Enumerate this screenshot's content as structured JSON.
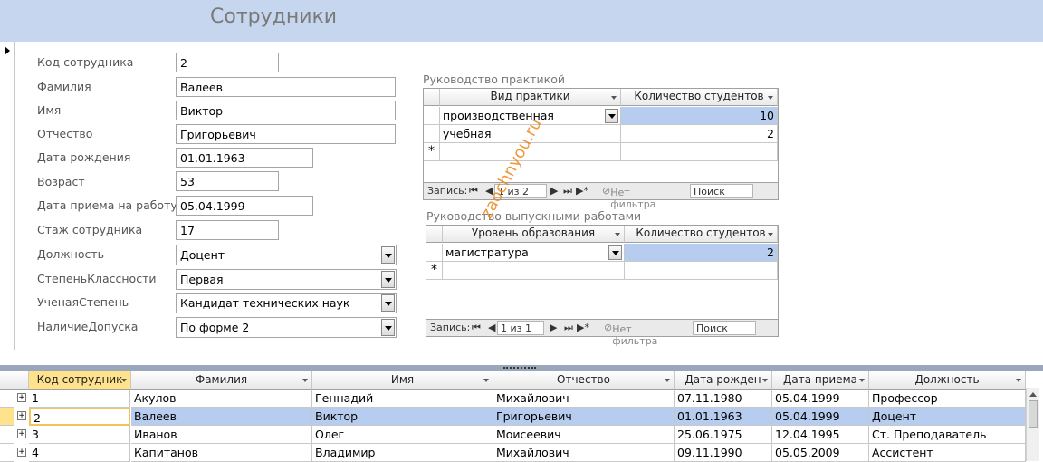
{
  "form": {
    "title": "Сотрудники",
    "fields": [
      {
        "label": "Код сотрудника",
        "value": "2"
      },
      {
        "label": "Фамилия",
        "value": "Валеев"
      },
      {
        "label": "Имя",
        "value": "Виктор"
      },
      {
        "label": "Отчество",
        "value": "Григорьевич"
      },
      {
        "label": "Дата рождения",
        "value": "01.01.1963"
      },
      {
        "label": "Возраст",
        "value": "53"
      },
      {
        "label": "Дата приема на работу",
        "value": "05.04.1999"
      },
      {
        "label": "Стаж сотрудника",
        "value": "17"
      }
    ],
    "combos": [
      {
        "label": "Должность",
        "value": "Доцент"
      },
      {
        "label": "СтепеньКлассности",
        "value": "Первая"
      },
      {
        "label": "УченаяСтепень",
        "value": "Кандидат технических наук"
      },
      {
        "label": "НаличиеДопуска",
        "value": "По форме 2"
      }
    ]
  },
  "practice": {
    "title": "Руководство практикой",
    "columns": [
      "Вид практики",
      "Количество студентов"
    ],
    "rows": [
      {
        "type": "производственная",
        "count": "10"
      },
      {
        "type": "учебная",
        "count": "2"
      }
    ],
    "new_row_marker": "*",
    "nav": {
      "label": "Запись:",
      "first": "⏮",
      "prev": "◀",
      "position": "1 из 2",
      "next": "▶",
      "last": "⏭",
      "new": "▶*",
      "filter": "Нет фильтра",
      "search": "Поиск"
    }
  },
  "theses": {
    "title": "Руководство выпускными работами",
    "columns": [
      "Уровень образования",
      "Количество студентов"
    ],
    "rows": [
      {
        "level": "магистратура",
        "count": "2"
      }
    ],
    "new_row_marker": "*",
    "nav": {
      "label": "Запись:",
      "first": "⏮",
      "prev": "◀",
      "position": "1 из 1",
      "next": "▶",
      "last": "⏭",
      "new": "▶*",
      "filter": "Нет фильтра",
      "search": "Поиск"
    }
  },
  "watermark": "zaochnyou.ru",
  "datasheet": {
    "columns": [
      "Код сотрудник",
      "Фамилия",
      "Имя",
      "Отчество",
      "Дата рожден",
      "Дата приема",
      "Должность"
    ],
    "rows": [
      {
        "id": "1",
        "last": "Акулов",
        "first": "Геннадий",
        "patr": "Михайлович",
        "birth": "07.11.1980",
        "hired": "05.04.1999",
        "pos": "Профессор"
      },
      {
        "id": "2",
        "last": "Валеев",
        "first": "Виктор",
        "patr": "Григорьевич",
        "birth": "01.01.1963",
        "hired": "05.04.1999",
        "pos": "Доцент"
      },
      {
        "id": "3",
        "last": "Иванов",
        "first": "Олег",
        "patr": "Моисеевич",
        "birth": "25.06.1975",
        "hired": "12.04.1995",
        "pos": "Ст. Преподаватель"
      },
      {
        "id": "4",
        "last": "Капитанов",
        "first": "Владимир",
        "patr": "Михайлович",
        "birth": "09.11.1990",
        "hired": "05.05.2009",
        "pos": "Ассистент"
      }
    ],
    "expander": "+"
  }
}
